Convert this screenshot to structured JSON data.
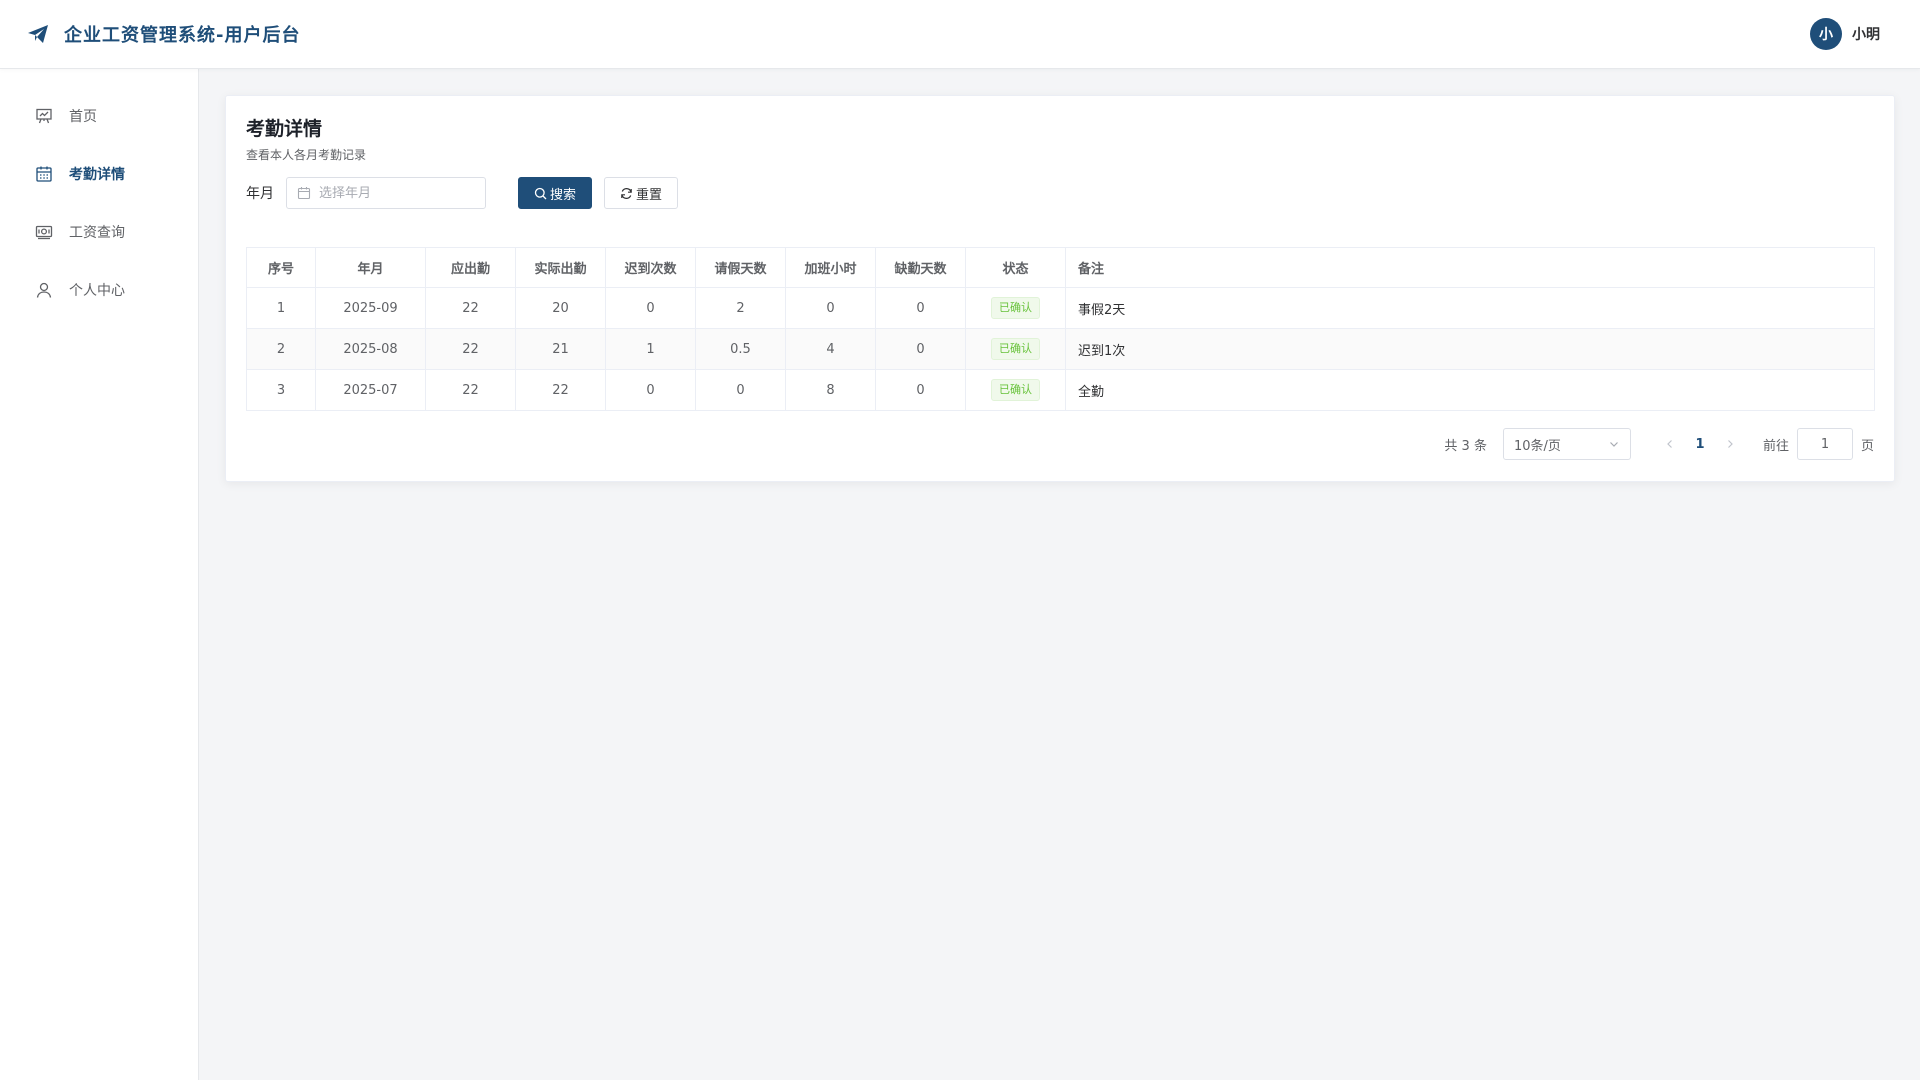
{
  "header": {
    "title": "企业工资管理系统-用户后台",
    "brand_icon": "paper-plane-icon",
    "avatar_text": "小",
    "user_name": "小明",
    "brand_color": "#1f4e79"
  },
  "sidebar": {
    "items": [
      {
        "label": "首页",
        "icon": "presentation-icon",
        "active": false
      },
      {
        "label": "考勤详情",
        "icon": "calendar-icon",
        "active": true
      },
      {
        "label": "工资查询",
        "icon": "money-icon",
        "active": false
      },
      {
        "label": "个人中心",
        "icon": "user-icon",
        "active": false
      }
    ]
  },
  "main": {
    "title": "考勤详情",
    "subtitle": "查看本人各月考勤记录",
    "filter": {
      "label": "年月",
      "placeholder": "选择年月",
      "value": ""
    },
    "buttons": {
      "search": "搜索",
      "reset": "重置"
    },
    "table": {
      "columns": [
        "序号",
        "年月",
        "应出勤",
        "实际出勤",
        "迟到次数",
        "请假天数",
        "加班小时",
        "缺勤天数",
        "状态",
        "备注"
      ],
      "rows": [
        {
          "index": "1",
          "month": "2025-09",
          "required": "22",
          "actual": "20",
          "late": "0",
          "leave": "2",
          "overtime": "0",
          "absent": "0",
          "status": "已确认",
          "note": "事假2天"
        },
        {
          "index": "2",
          "month": "2025-08",
          "required": "22",
          "actual": "21",
          "late": "1",
          "leave": "0.5",
          "overtime": "4",
          "absent": "0",
          "status": "已确认",
          "note": "迟到1次"
        },
        {
          "index": "3",
          "month": "2025-07",
          "required": "22",
          "actual": "22",
          "late": "0",
          "leave": "0",
          "overtime": "8",
          "absent": "0",
          "status": "已确认",
          "note": "全勤"
        }
      ]
    },
    "pagination": {
      "total": "共 3 条",
      "page_size": "10条/页",
      "current_page": "1",
      "goto_label": "前往",
      "goto_value": "1",
      "page_suffix": "页"
    }
  }
}
